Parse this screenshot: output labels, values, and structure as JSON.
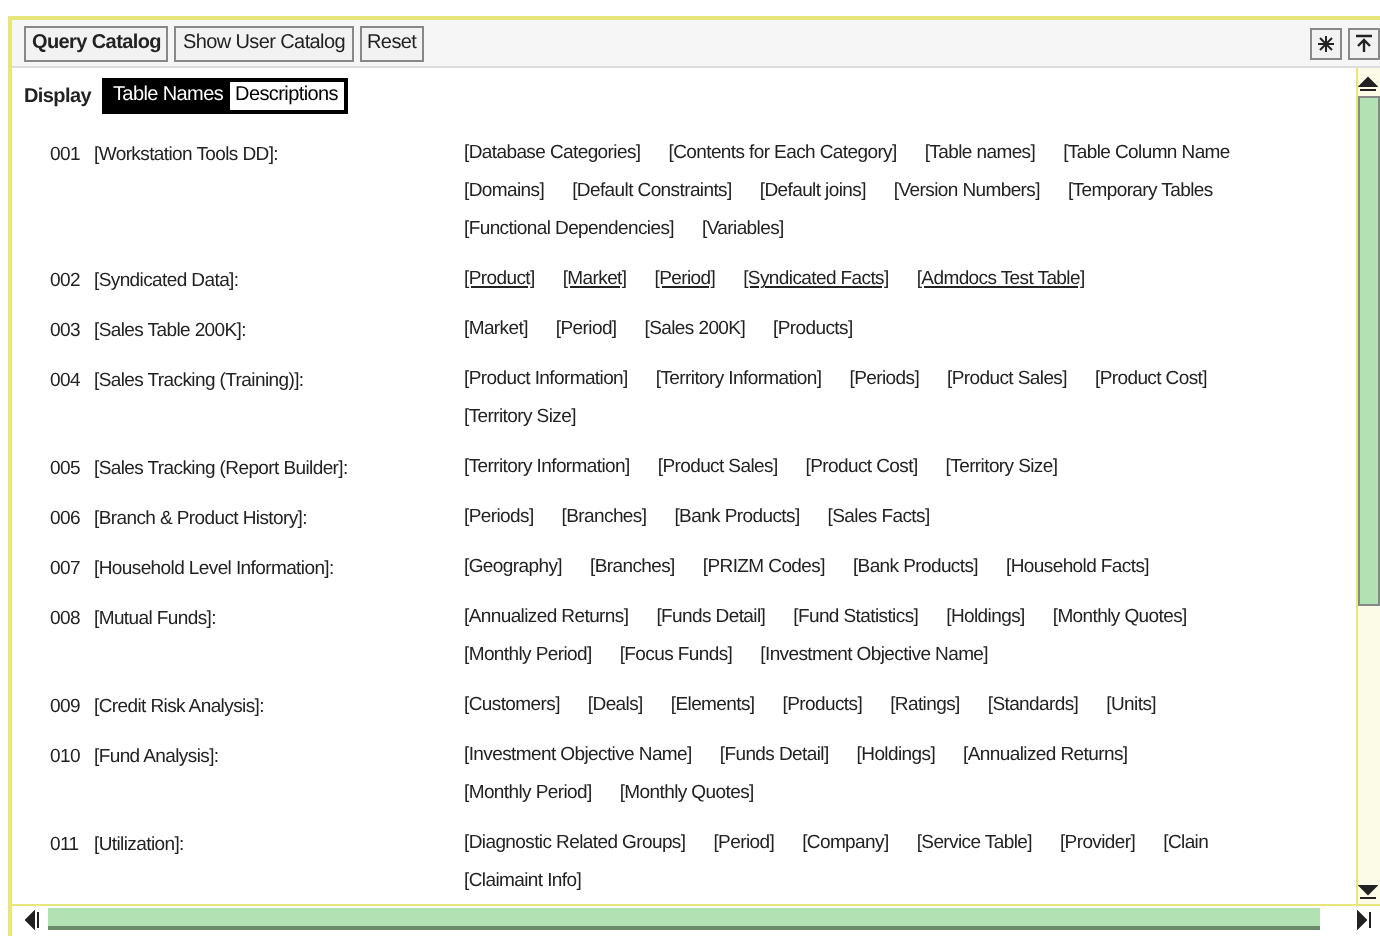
{
  "toolbar": {
    "buttons": [
      {
        "label": "Query Catalog",
        "selected": true
      },
      {
        "label": "Show User Catalog",
        "selected": false
      },
      {
        "label": "Reset",
        "selected": false
      }
    ]
  },
  "display": {
    "label": "Display",
    "options": [
      {
        "label": "Table Names",
        "selected": true
      },
      {
        "label": "Descriptions",
        "selected": false
      }
    ]
  },
  "catalogs": [
    {
      "number": "001",
      "name": "[Workstation Tools DD]:",
      "linked": false,
      "lines": [
        [
          "[Database Categories]",
          "[Contents for Each Category]",
          "[Table names]",
          "[Table Column Name"
        ],
        [
          "[Domains]",
          "[Default Constraints]",
          "[Default joins]",
          "[Version Numbers]",
          "[Temporary Tables"
        ],
        [
          "[Functional Dependencies]",
          "[Variables]"
        ]
      ]
    },
    {
      "number": "002",
      "name": "[Syndicated Data]:",
      "linked": true,
      "lines": [
        [
          "[Product]",
          "[Market]",
          "[Period]",
          "[Syndicated Facts]",
          "[Admdocs Test Table]"
        ]
      ]
    },
    {
      "number": "003",
      "name": "[Sales Table 200K]:",
      "linked": false,
      "lines": [
        [
          "[Market]",
          "[Period]",
          "[Sales 200K]",
          "[Products]"
        ]
      ]
    },
    {
      "number": "004",
      "name": "[Sales Tracking (Training)]:",
      "linked": false,
      "lines": [
        [
          "[Product Information]",
          "[Territory Information]",
          "[Periods]",
          "[Product Sales]",
          "[Product Cost]"
        ],
        [
          "[Territory Size]"
        ]
      ]
    },
    {
      "number": "005",
      "name": "[Sales Tracking (Report Builder]:",
      "linked": false,
      "lines": [
        [
          "[Territory Information]",
          "[Product Sales]",
          "[Product Cost]",
          "[Territory Size]"
        ]
      ]
    },
    {
      "number": "006",
      "name": "[Branch & Product History]:",
      "linked": false,
      "lines": [
        [
          "[Periods]",
          "[Branches]",
          "[Bank Products]",
          "[Sales Facts]"
        ]
      ]
    },
    {
      "number": "007",
      "name": "[Household Level Information]:",
      "linked": false,
      "lines": [
        [
          "[Geography]",
          "[Branches]",
          "[PRIZM Codes]",
          "[Bank Products]",
          "[Household Facts]"
        ]
      ]
    },
    {
      "number": "008",
      "name": "[Mutual Funds]:",
      "linked": false,
      "lines": [
        [
          "[Annualized Returns]",
          "[Funds Detail]",
          "[Fund Statistics]",
          "[Holdings]",
          "[Monthly Quotes]"
        ],
        [
          "[Monthly Period]",
          "[Focus Funds]",
          "[Investment Objective Name]"
        ]
      ]
    },
    {
      "number": "009",
      "name": "[Credit Risk Analysis]:",
      "linked": false,
      "lines": [
        [
          "[Customers]",
          "[Deals]",
          "[Elements]",
          "[Products]",
          "[Ratings]",
          "[Standards]",
          "[Units]"
        ]
      ]
    },
    {
      "number": "010",
      "name": "[Fund Analysis]:",
      "linked": false,
      "lines": [
        [
          "[Investment Objective Name]",
          "[Funds Detail]",
          "[Holdings]",
          "[Annualized Returns]"
        ],
        [
          "[Monthly Period]",
          "[Monthly Quotes]"
        ]
      ]
    },
    {
      "number": "011",
      "name": "[Utilization]:",
      "linked": false,
      "lines": [
        [
          "[Diagnostic Related Groups]",
          "[Period]",
          "[Company]",
          "[Service Table]",
          "[Provider]",
          "[Clain"
        ],
        [
          "[Claimaint Info]"
        ]
      ]
    }
  ]
}
